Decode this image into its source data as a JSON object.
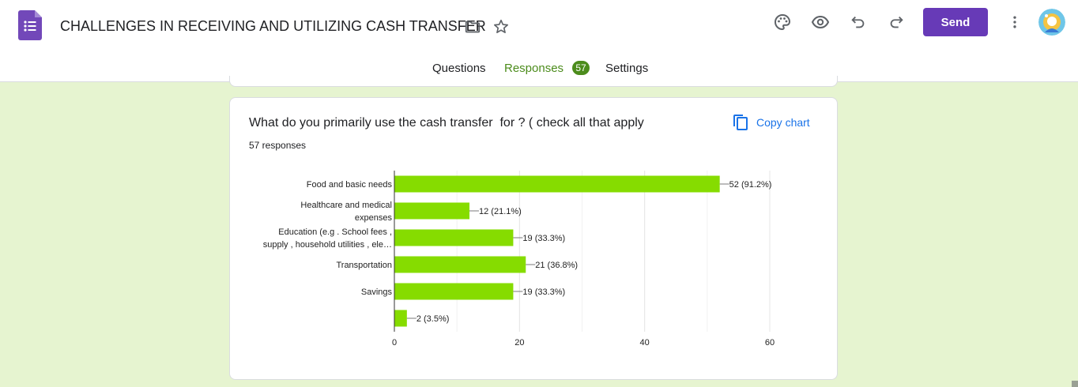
{
  "header": {
    "title": "CHALLENGES IN RECEIVING AND UTILIZING CASH TRANSFER",
    "send_label": "Send",
    "icons": [
      "forms-logo-icon",
      "folder-icon",
      "star-icon",
      "palette-icon",
      "preview-eye-icon",
      "undo-icon",
      "redo-icon",
      "more-vert-icon",
      "avatar"
    ]
  },
  "tabs": [
    {
      "label": "Questions"
    },
    {
      "label": "Responses",
      "badge": "57",
      "active": true
    },
    {
      "label": "Settings"
    }
  ],
  "question_card": {
    "title": "What do you primarily use the cash transfer  for ? ( check all that apply",
    "responses": "57 responses",
    "copy_label": "Copy chart"
  },
  "chart_data": {
    "type": "bar",
    "orientation": "horizontal",
    "categories": [
      [
        "Food and basic needs"
      ],
      [
        "Healthcare and medical",
        "expenses"
      ],
      [
        "Education (e.g . School fees ,",
        "supply , household utilities , ele…"
      ],
      [
        "Transportation"
      ],
      [
        "Savings"
      ],
      [
        ""
      ]
    ],
    "values": [
      52,
      12,
      19,
      21,
      19,
      2
    ],
    "data_labels": [
      "52 (91.2%)",
      "12 (21.1%)",
      "19 (33.3%)",
      "21 (36.8%)",
      "19 (33.3%)",
      "2 (3.5%)"
    ],
    "xlim": [
      0,
      60
    ],
    "xticks": [
      0,
      20,
      40,
      60
    ],
    "grid": true,
    "bar_color": "#86dc00"
  },
  "colors": {
    "accent": "#673ab7",
    "response_accent": "#4c8c1c",
    "page_bg": "#e6f4d0",
    "link": "#1a73e8"
  }
}
